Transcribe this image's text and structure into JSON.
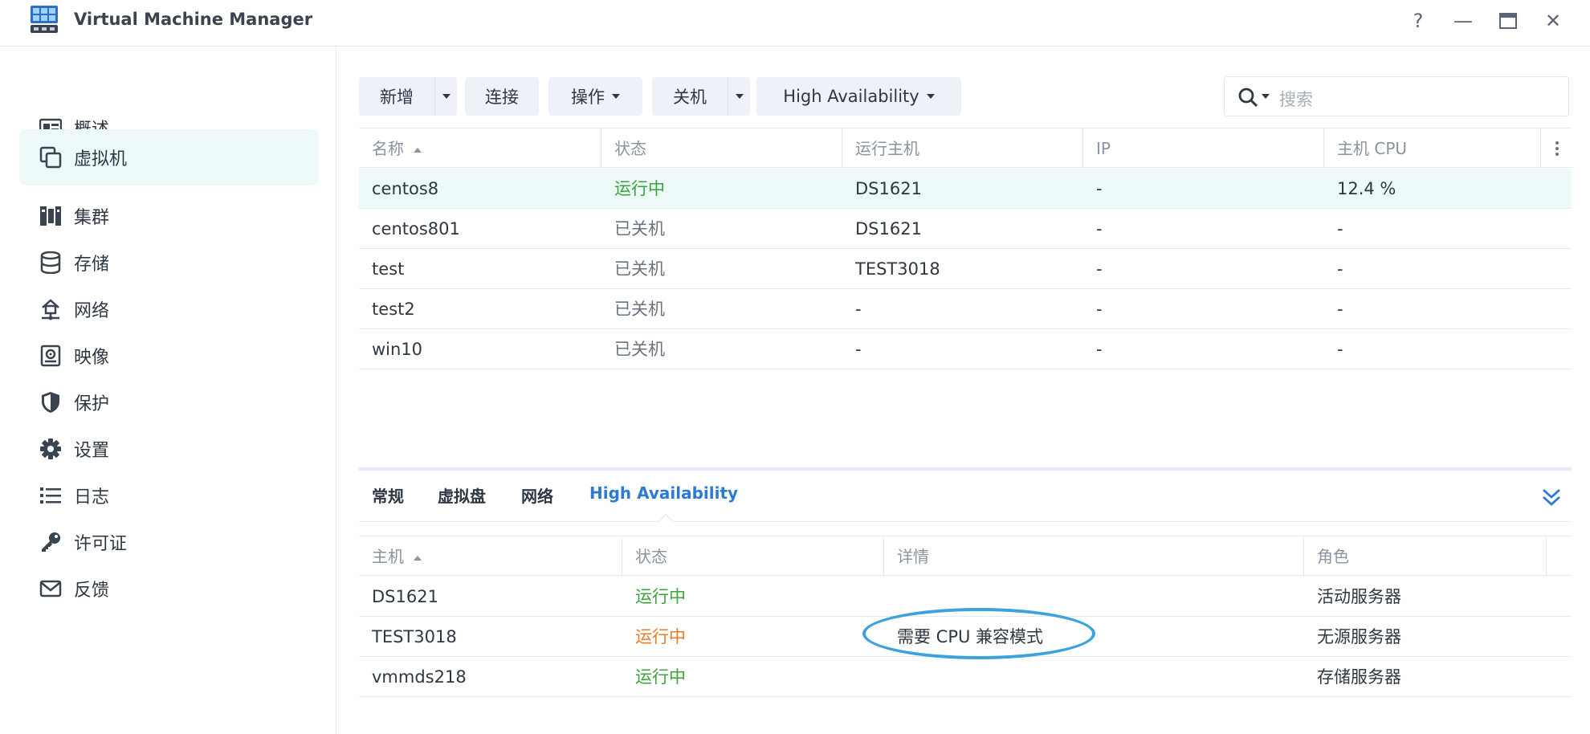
{
  "window": {
    "title": "Virtual Machine Manager",
    "controls": [
      "?",
      "—",
      "▭",
      "✕"
    ]
  },
  "sidebar": {
    "items": [
      {
        "label": "概述",
        "icon": "overview-icon"
      },
      {
        "label": "虚拟机",
        "icon": "virtual-machine-icon",
        "active": true
      },
      {
        "label": "集群",
        "icon": "cluster-icon"
      },
      {
        "label": "存储",
        "icon": "storage-icon"
      },
      {
        "label": "网络",
        "icon": "network-icon"
      },
      {
        "label": "映像",
        "icon": "image-icon"
      },
      {
        "label": "保护",
        "icon": "shield-icon"
      },
      {
        "label": "设置",
        "icon": "gear-icon"
      },
      {
        "label": "日志",
        "icon": "list-icon"
      },
      {
        "label": "许可证",
        "icon": "key-icon"
      },
      {
        "label": "反馈",
        "icon": "mail-icon"
      }
    ]
  },
  "toolbar": {
    "create": "新增",
    "connect": "连接",
    "action": "操作",
    "shutdown": "关机",
    "ha": "High Availability",
    "search_placeholder": "搜索"
  },
  "vm_table": {
    "headers": [
      "名称",
      "状态",
      "运行主机",
      "IP",
      "主机 CPU"
    ],
    "rows": [
      {
        "name": "centos8",
        "status": "运行中",
        "host": "DS1621",
        "ip": "-",
        "cpu": "12.4 %"
      },
      {
        "name": "centos801",
        "status": "已关机",
        "host": "DS1621",
        "ip": "-",
        "cpu": "-"
      },
      {
        "name": "test",
        "status": "已关机",
        "host": "TEST3018",
        "ip": "-",
        "cpu": "-"
      },
      {
        "name": "test2",
        "status": "已关机",
        "host": "-",
        "ip": "-",
        "cpu": "-"
      },
      {
        "name": "win10",
        "status": "已关机",
        "host": "-",
        "ip": "-",
        "cpu": "-"
      }
    ]
  },
  "detail_tabs": [
    "常规",
    "虚拟盘",
    "网络",
    "High Availability"
  ],
  "ha_table": {
    "headers": [
      "主机",
      "状态",
      "详情",
      "角色"
    ],
    "rows": [
      {
        "host": "DS1621",
        "status": "运行中",
        "detail": "",
        "role": "活动服务器"
      },
      {
        "host": "TEST3018",
        "status": "运行中",
        "detail": "需要 CPU 兼容模式",
        "role": "无源服务器"
      },
      {
        "host": "vmmds218",
        "status": "运行中",
        "detail": "",
        "role": "存储服务器"
      }
    ]
  },
  "colors": {
    "accent": "#2b7bd6",
    "running": "#3aa43a",
    "warning": "#f07a20",
    "highlight_ring": "#3aa2dc"
  }
}
